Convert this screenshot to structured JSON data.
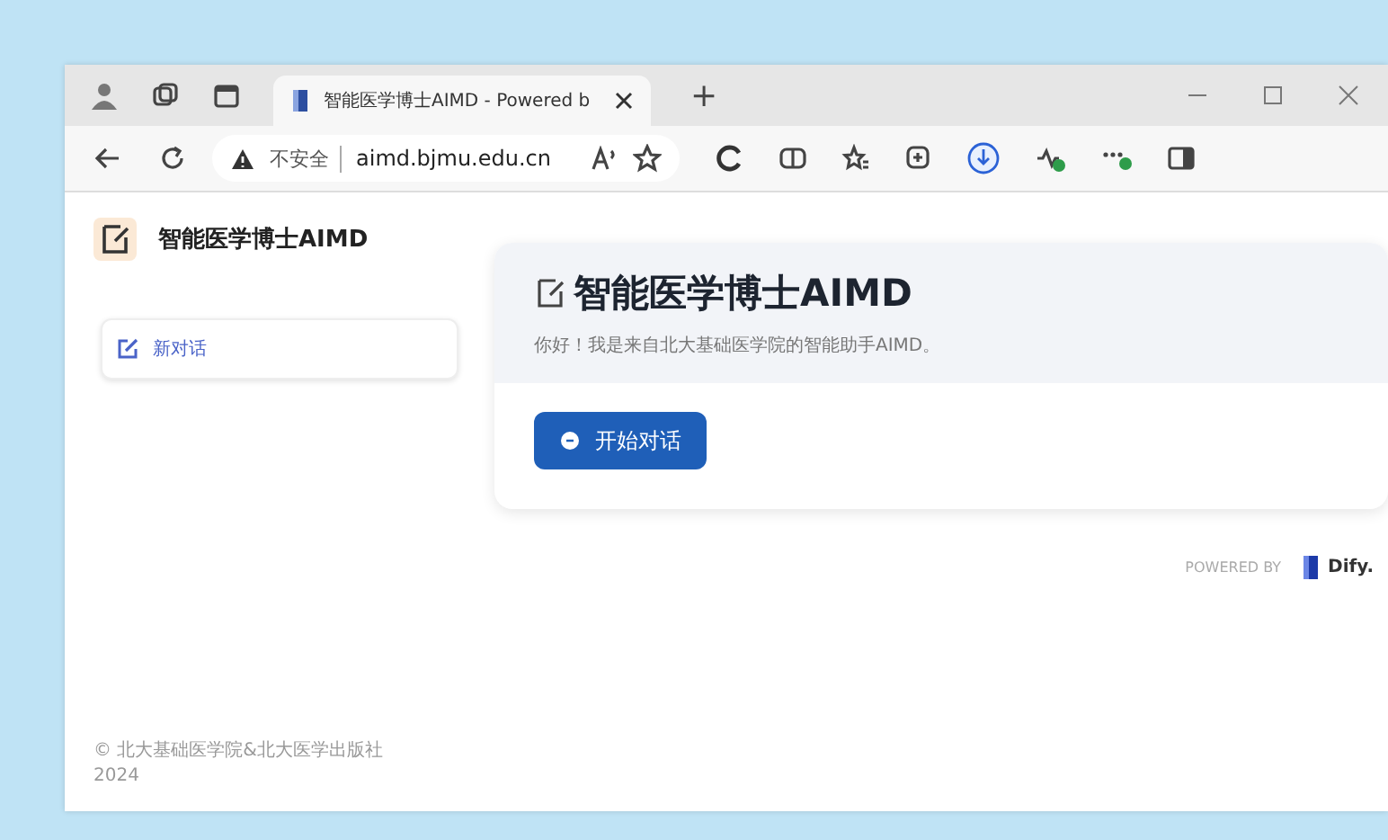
{
  "browser": {
    "tab": {
      "title": "智能医学博士AIMD - Powered b",
      "selected": true
    },
    "new_tab": "+",
    "address": {
      "security": "不安全",
      "url": "aimd.bjmu.edu.cn"
    }
  },
  "app": {
    "name": "智能医学博士AIMD"
  },
  "sidebar": {
    "items": [
      {
        "label": "新对话",
        "selected": true
      }
    ],
    "copyright": "© 北大基础医学院&北大医学出版社",
    "year": "2024"
  },
  "welcome": {
    "title": "智能医学博士AIMD",
    "subtitle": "你好！我是来自北大基础医学院的智能助手AIMD。",
    "button": "开始对话"
  },
  "powered_by": {
    "label": "POWERED BY",
    "brand": "Dify."
  }
}
